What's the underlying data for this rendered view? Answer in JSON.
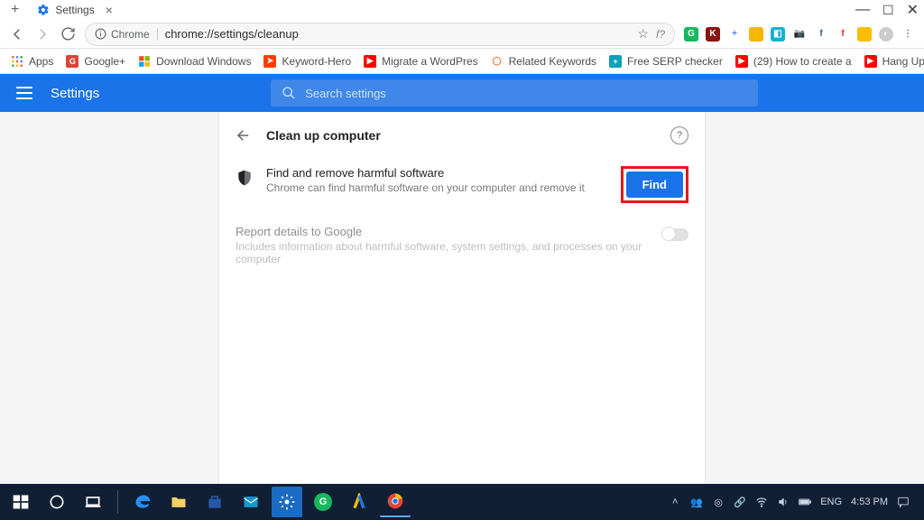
{
  "window": {
    "controls": [
      "minimize",
      "maximize",
      "close"
    ]
  },
  "tab": {
    "title": "Settings"
  },
  "nav": {
    "security_label": "Chrome",
    "url": "chrome://settings/cleanup",
    "star_title": "Bookmark this page",
    "f_question": "f?"
  },
  "extensions": [
    {
      "name": "grammarly",
      "bg": "#16b85e",
      "glyph": "G"
    },
    {
      "name": "ext-k",
      "bg": "#8a1414",
      "glyph": "K"
    },
    {
      "name": "plus-ext",
      "bg": "#ffffff",
      "glyph": "+",
      "fg": "#4b7bd8"
    },
    {
      "name": "yellow-ext",
      "bg": "#f6b600",
      "glyph": ""
    },
    {
      "name": "screenshot",
      "bg": "#18b2d1",
      "glyph": "◧"
    },
    {
      "name": "camera",
      "bg": "#ffffff",
      "glyph": "📷",
      "fg": "#4f9fe6"
    },
    {
      "name": "fb",
      "bg": "#ffffff",
      "glyph": "f",
      "fg": "#3b5998"
    },
    {
      "name": "red-f",
      "bg": "#ffffff",
      "glyph": "f",
      "fg": "#d33"
    },
    {
      "name": "bookmark-ext",
      "bg": "#fbbc04",
      "glyph": ""
    },
    {
      "name": "avatar",
      "bg": "#ccc",
      "glyph": "◐",
      "round": true
    },
    {
      "name": "menu",
      "bg": "transparent",
      "glyph": "⋮",
      "fg": "#5f6368"
    }
  ],
  "bookmarks": [
    {
      "label": "Apps",
      "icon_bg": "transparent",
      "icon": "grid"
    },
    {
      "label": "Google+",
      "icon_bg": "#db4437",
      "glyph": "G"
    },
    {
      "label": "Download Windows",
      "icon_bg": "transparent",
      "icon": "ms"
    },
    {
      "label": "Keyword-Hero",
      "icon_bg": "#ff3d00",
      "glyph": "➤"
    },
    {
      "label": "Migrate a WordPres",
      "icon_bg": "#ff0000",
      "glyph": "▶"
    },
    {
      "label": "Related Keywords",
      "icon_bg": "#ffffff",
      "glyph": "◯",
      "fg": "#e86b2e"
    },
    {
      "label": "Free SERP checker",
      "icon_bg": "#0aa3b8",
      "glyph": "+"
    },
    {
      "label": "(29) How to create a",
      "icon_bg": "#ff0000",
      "glyph": "▶"
    },
    {
      "label": "Hang Ups (Want Yo",
      "icon_bg": "#ff0000",
      "glyph": "▶"
    }
  ],
  "bookmarks_overflow": "»",
  "settings_header": {
    "title": "Settings",
    "search_placeholder": "Search settings"
  },
  "panel": {
    "title": "Clean up computer",
    "item1_title": "Find and remove harmful software",
    "item1_sub": "Chrome can find harmful software on your computer and remove it",
    "find_label": "Find",
    "item2_title": "Report details to Google",
    "item2_sub": "Includes information about harmful software, system settings, and processes on your computer",
    "toggle_on": false
  },
  "taskbar": {
    "tray": {
      "lang": "ENG",
      "time": "4:53 PM"
    }
  }
}
